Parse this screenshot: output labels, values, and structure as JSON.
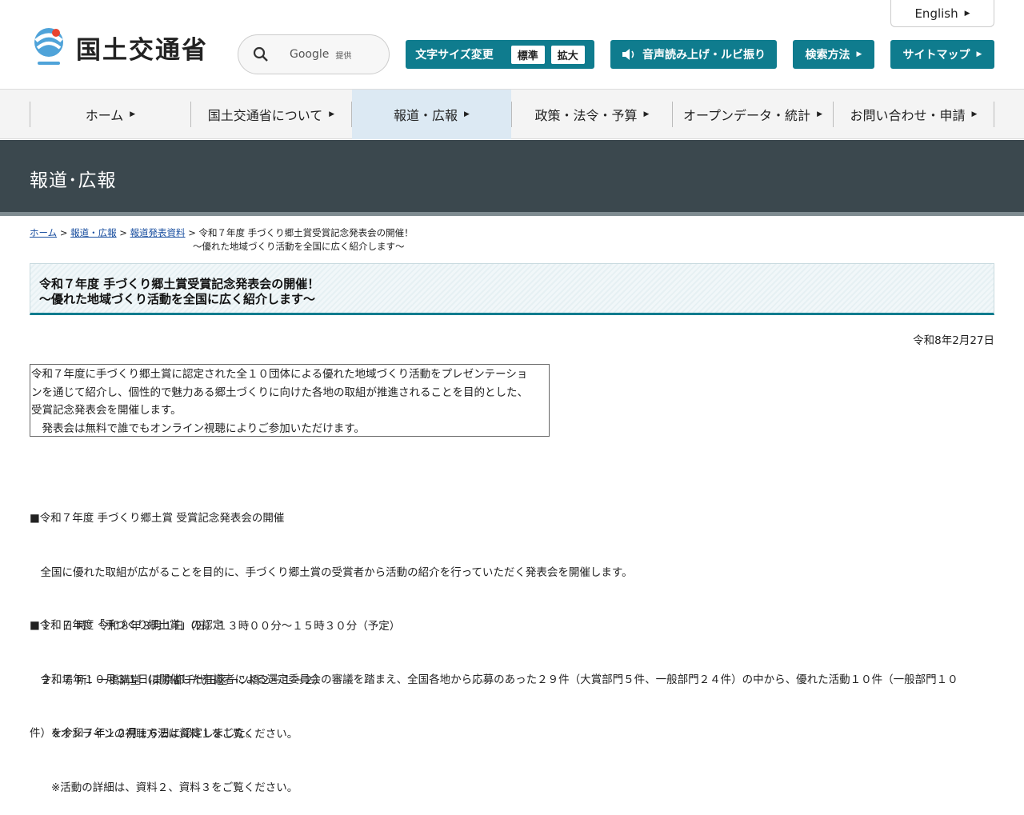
{
  "header": {
    "logo_text": "国土交通省",
    "search": {
      "provider": "Google",
      "provider_sub": "提供"
    },
    "english_label": "English",
    "font_size": {
      "label": "文字サイズ変更",
      "options": [
        "標準",
        "拡大"
      ]
    },
    "speech_label": "音声読み上げ・ルビ振り",
    "search_method_label": "検索方法",
    "sitemap_label": "サイトマップ"
  },
  "nav": {
    "items": [
      "ホーム",
      "国土交通省について",
      "報道・広報",
      "政策・法令・予算",
      "オープンデータ・統計",
      "お問い合わせ・申請"
    ],
    "active": "報道・広報"
  },
  "banner": {
    "title": "報道･広報"
  },
  "breadcrumb": {
    "links": [
      "ホーム",
      "報道・広報",
      "報道発表資料"
    ],
    "separator": ">",
    "current_line1": "令和７年度 手づくり郷土賞受賞記念発表会の開催！",
    "current_line2": "～優れた地域づくり活動を全国に広く紹介します～"
  },
  "article": {
    "title_line1": "令和７年度 手づくり郷土賞受賞記念発表会の開催！",
    "title_line2": "～優れた地域づくり活動を全国に広く紹介します～",
    "date": "令和8年2月27日",
    "summary": [
      "令和７年度に手づくり郷土賞に認定された全１０団体による優れた地域づくり活動をプレゼンテーショ",
      "ンを通じて紹介し、個性的で魅力ある郷土づくりに向けた各地の取組が推進されることを目的とした、",
      "受賞記念発表会を開催します。",
      "　発表会は無料で誰でもオンライン視聴によりご参加いただけます。"
    ],
    "section1": {
      "heading": "■令和７年度 手づくり郷土賞 受賞記念発表会の開催",
      "lines": [
        "　全国に優れた取組が広がることを目的に、手づくり郷土賞の受賞者から活動の紹介を行っていただく発表会を開催します。",
        "　１．日 時：令和８年３月１日（日）１３時００分～１５時３０分（予定）",
        "　２．場 所：一橋講堂（東京都千代田区一ツ橋２－１－２）",
        "　　※オンラインの視聴方法は資料１をご覧ください。"
      ]
    },
    "section2": {
      "heading": "■令和７年度「手づくり郷土賞」の認定",
      "lines": [
        "　令和７年１０月３１日に開催した有識者による選定委員会の審議を踏まえ、全国各地から応募のあった２９件（大賞部門５件、一般部門２４件）の中から、優れた活動１０件（一般部門１０",
        "件）を令和７年１２月１６日に認定しました。",
        "　　※活動の詳細は、資料２、資料３をご覧ください。"
      ]
    }
  },
  "colors": {
    "teal": "#0f7c8e",
    "banner": "#3b484e",
    "nav_active": "#dce9f3"
  }
}
